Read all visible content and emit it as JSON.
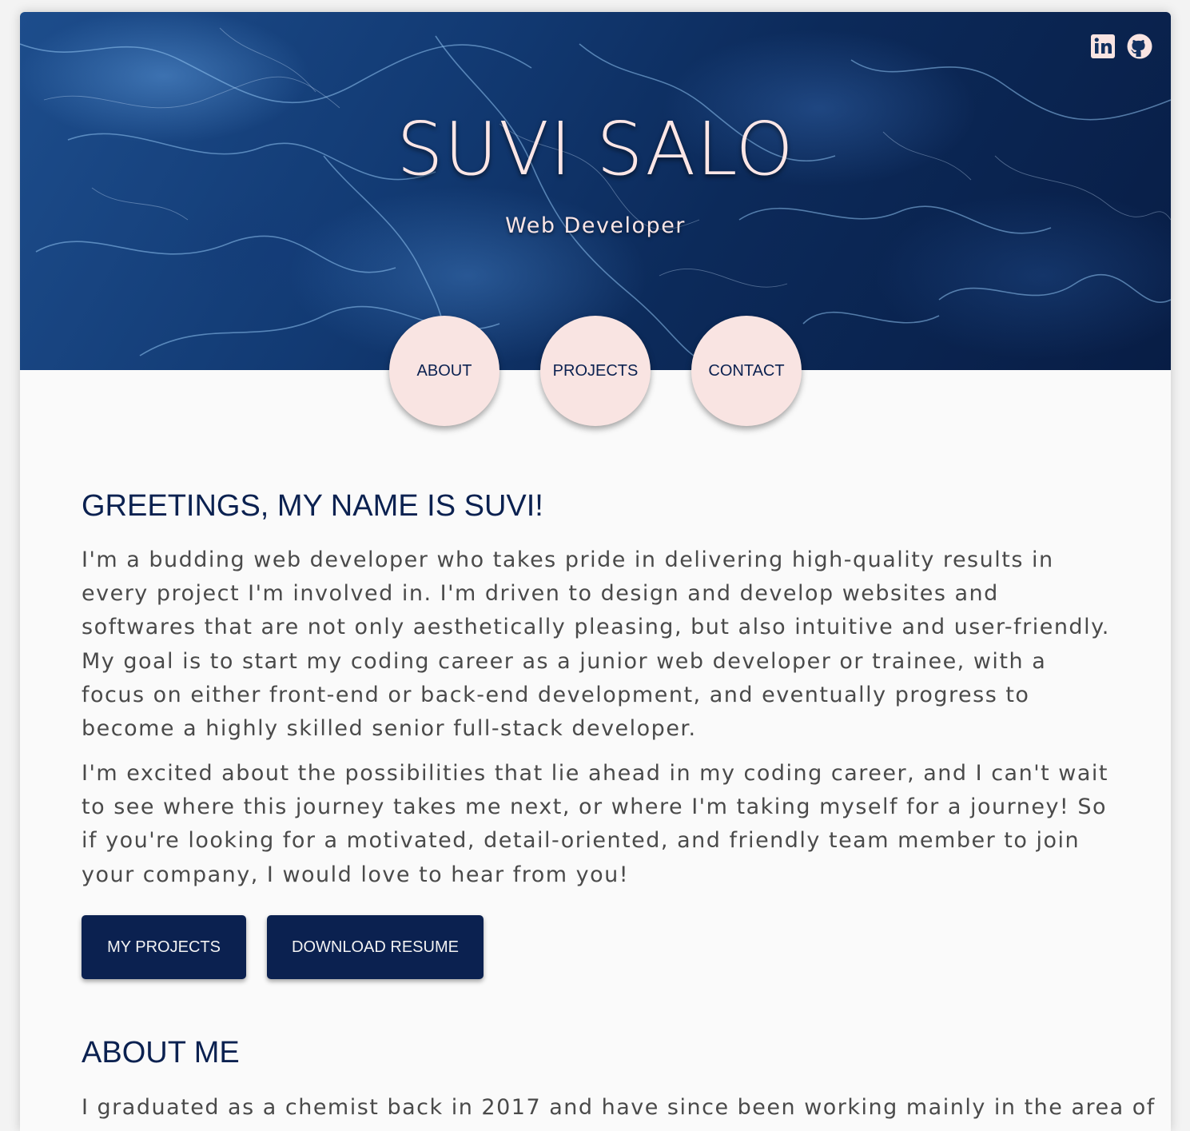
{
  "header": {
    "name": "SUVI SALO",
    "tagline": "Web Developer",
    "socials": [
      {
        "icon": "linkedin-icon"
      },
      {
        "icon": "github-icon"
      }
    ]
  },
  "nav": {
    "items": [
      {
        "label": "ABOUT"
      },
      {
        "label": "PROJECTS"
      },
      {
        "label": "CONTACT"
      }
    ]
  },
  "greeting": {
    "title": "GREETINGS, MY NAME IS SUVI!",
    "paragraph1": "I'm a budding web developer who takes pride in delivering high-quality results in every project I'm involved in. I'm driven to design and develop websites and softwares that are not only aesthetically pleasing, but also intuitive and user-friendly. My goal is to start my coding career as a junior web developer or trainee, with a focus on either front-end or back-end development, and eventually progress to become a highly skilled senior full-stack developer.",
    "paragraph2": "I'm excited about the possibilities that lie ahead in my coding career, and I can't wait to see where this journey takes me next, or where I'm taking myself for a journey! So if you're looking for a motivated, detail-oriented, and friendly team member to join your company, I would love to hear from you!"
  },
  "buttons": {
    "projects_label": "MY PROJECTS",
    "resume_label": "DOWNLOAD RESUME"
  },
  "about": {
    "title": "ABOUT ME",
    "paragraph": "I graduated as a chemist back in 2017 and have since been working mainly in the area of"
  },
  "colors": {
    "navy": "#0b2150",
    "pink": "#f9e4e2",
    "text": "#4a4a4a",
    "page_bg": "#fafafa"
  }
}
